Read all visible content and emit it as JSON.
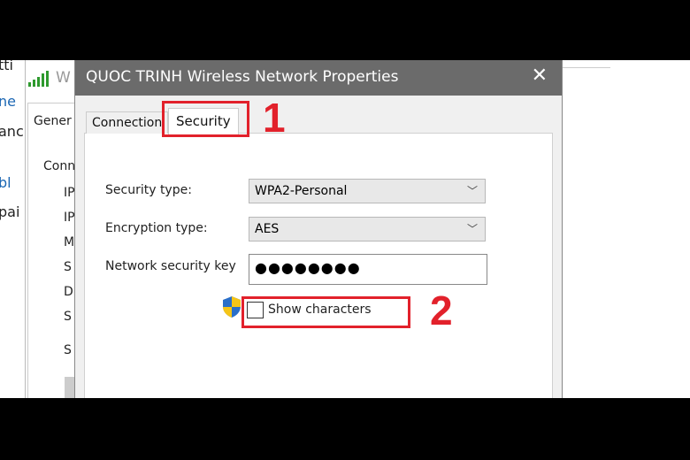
{
  "background": {
    "left_fragments": [
      "tti",
      "ne",
      "anc",
      "bl",
      "pai"
    ],
    "window_title_fragment": "W",
    "tab": "Gener",
    "items": [
      "Conn",
      "IP",
      "IP",
      "M",
      "S",
      "D",
      "S",
      "S"
    ]
  },
  "dialog": {
    "title": "QUOC TRINH Wireless Network Properties",
    "close_icon": "close-icon",
    "tabs": [
      {
        "label": "Connection"
      },
      {
        "label": "Security",
        "active": true
      }
    ],
    "security_type": {
      "label": "Security type:",
      "value": "WPA2-Personal"
    },
    "encryption_type": {
      "label": "Encryption type:",
      "value": "AES"
    },
    "key": {
      "label": "Network security key",
      "value": "●●●●●●●●"
    },
    "show_characters": {
      "label": "Show characters",
      "checked": false
    }
  },
  "annotations": {
    "step1": "1",
    "step2": "2",
    "highlight_color": "#e2212b"
  }
}
